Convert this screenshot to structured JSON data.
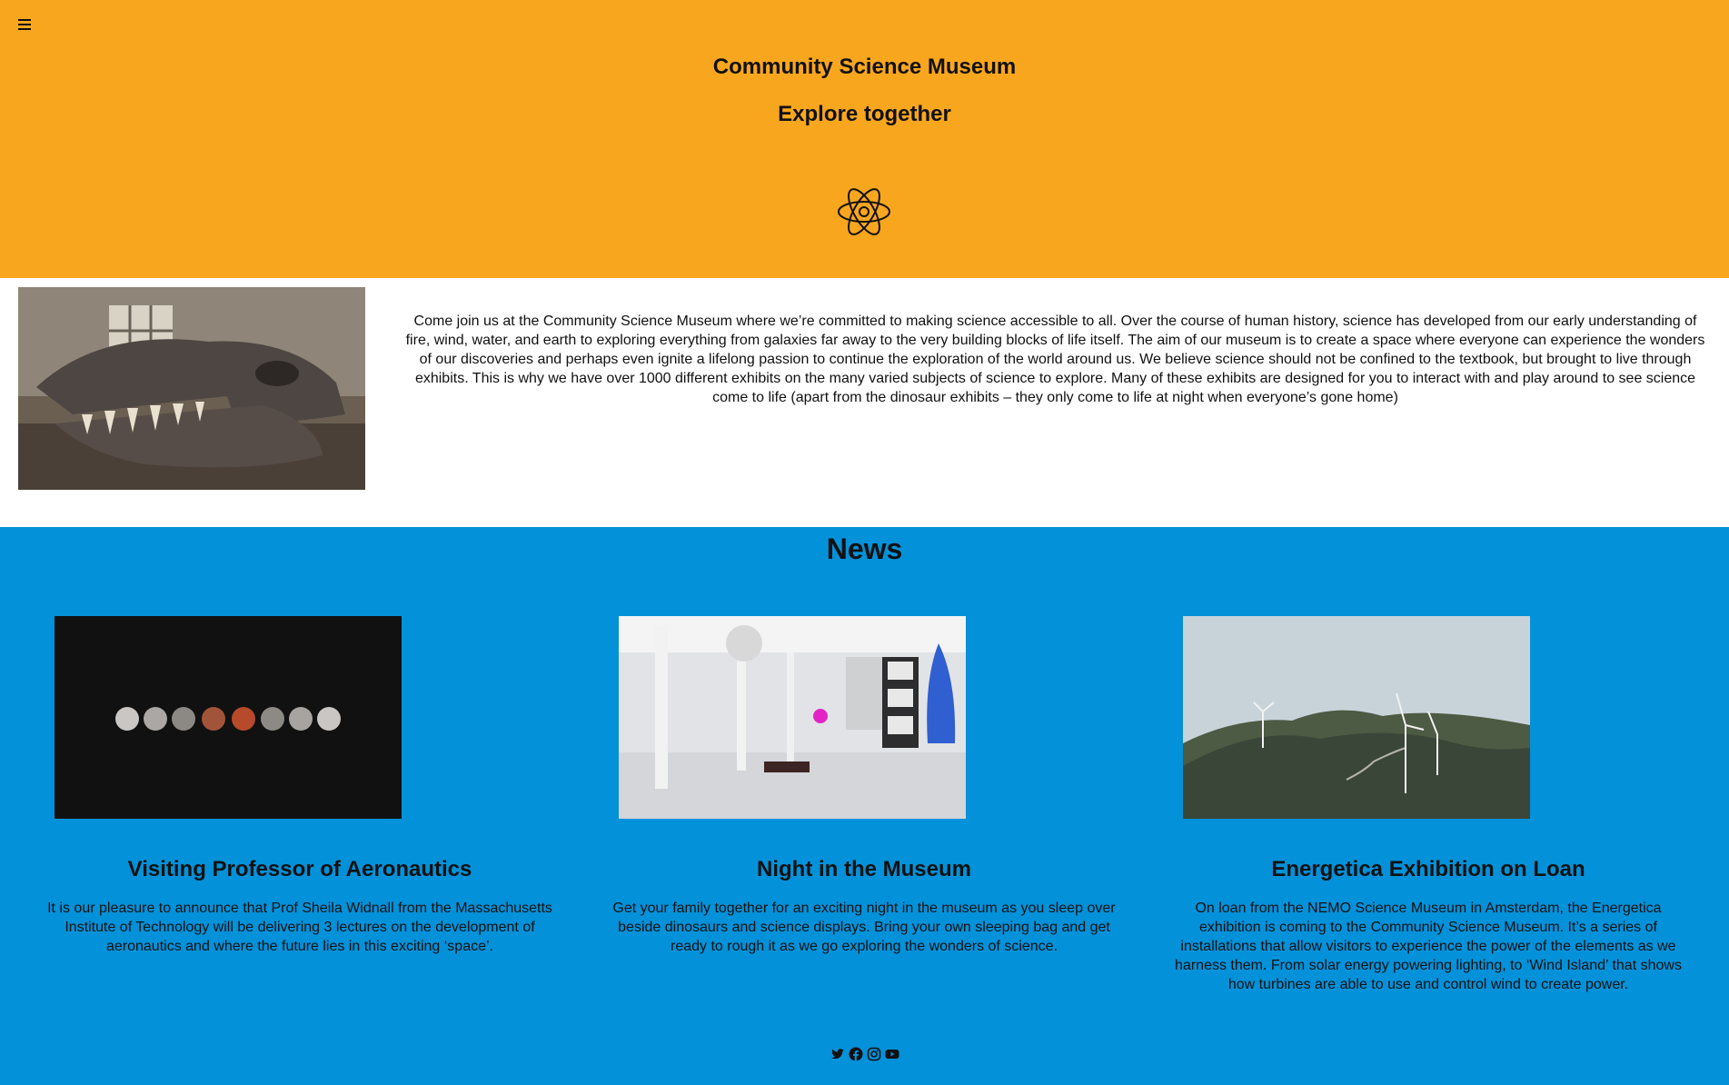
{
  "header": {
    "title": "Community Science Museum",
    "tagline": "Explore together",
    "menu_icon": "hamburger-menu-icon",
    "logo_icon": "atom-icon"
  },
  "intro": {
    "image": "dinosaur skull exhibit photo",
    "text": "Come join us at the Community Science Museum where we’re committed to making science accessible to all. Over the course of human history, science has developed from our early understanding of fire, wind, water, and earth to exploring everything from galaxies far away to the very building blocks of life itself. The aim of our museum is to create a space where everyone can experience the wonders of our discoveries and perhaps even ignite a lifelong passion to continue the exploration of the world around us. We believe science should not be confined to the textbook, but brought to live through exhibits. This is why we have over 1000 different exhibits on the many varied subjects of science to explore. Many of these exhibits are designed for you to interact with and play around to see science come to life (apart from the dinosaur exhibits – they only come to life at night when everyone’s gone home)"
  },
  "news": {
    "title": "News",
    "items": [
      {
        "title": "Visiting Professor of Aeronautics",
        "body": "It is our pleasure to announce that Prof Sheila Widnall from the Massachusetts Institute of Technology will be delivering 3 lectures on the development of aeronautics and where the future lies in this exciting ‘space’."
      },
      {
        "title": "Night in the Museum",
        "body": "Get your family together for an exciting night in the museum as you sleep over beside dinosaurs and science displays. Bring your own sleeping bag and get ready to rough it as we go exploring the wonders of science."
      },
      {
        "title": "Energetica Exhibition on Loan",
        "body": "On loan from the NEMO Science Museum in Amsterdam, the Energetica exhibition is coming to the Community Science Museum. It’s a series of installations that allow visitors to experience the power of the elements as we harness them. From solar energy powering lighting, to ‘Wind Island’ that shows how turbines are able to use and control wind to create power."
      }
    ]
  },
  "footer": {
    "social_icons": [
      "twitter-icon",
      "facebook-icon",
      "instagram-icon",
      "youtube-icon"
    ]
  },
  "colors": {
    "header_bg": "#f9a61f",
    "news_bg": "#0391d9",
    "intro_bg": "#ffffff"
  }
}
